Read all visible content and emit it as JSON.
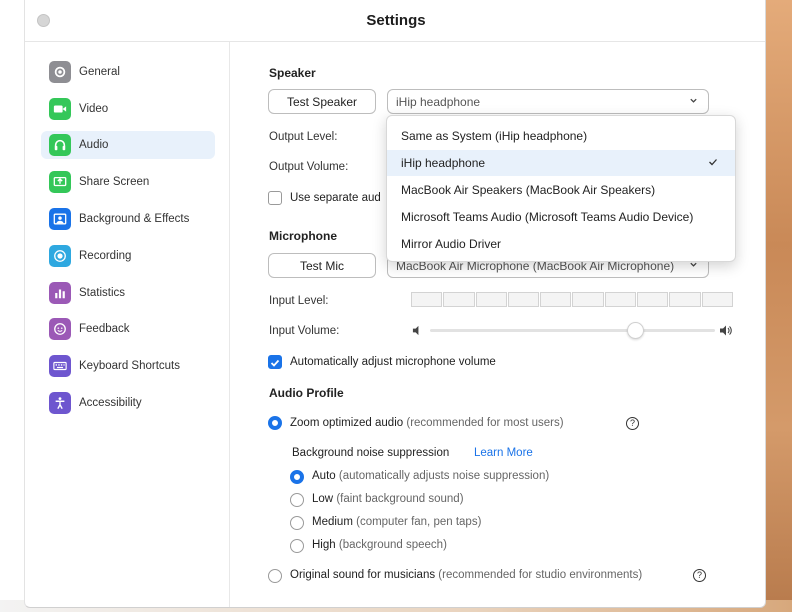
{
  "window": {
    "title": "Settings"
  },
  "sidebar": {
    "items": [
      {
        "label": "General",
        "icon": "gear-icon",
        "color": "#8e8e93",
        "active": false
      },
      {
        "label": "Video",
        "icon": "video-camera-icon",
        "color": "#34c759",
        "active": false
      },
      {
        "label": "Audio",
        "icon": "headphones-icon",
        "color": "#34c759",
        "active": true
      },
      {
        "label": "Share Screen",
        "icon": "share-screen-icon",
        "color": "#34c759",
        "active": false
      },
      {
        "label": "Background & Effects",
        "icon": "background-icon",
        "color": "#1a73e8",
        "active": false
      },
      {
        "label": "Recording",
        "icon": "recording-icon",
        "color": "#2ea8e0",
        "active": false
      },
      {
        "label": "Statistics",
        "icon": "statistics-icon",
        "color": "#9b59b6",
        "active": false
      },
      {
        "label": "Feedback",
        "icon": "feedback-icon",
        "color": "#9b59b6",
        "active": false
      },
      {
        "label": "Keyboard Shortcuts",
        "icon": "keyboard-icon",
        "color": "#6e56cf",
        "active": false
      },
      {
        "label": "Accessibility",
        "icon": "accessibility-icon",
        "color": "#6e56cf",
        "active": false
      }
    ]
  },
  "speaker": {
    "title": "Speaker",
    "test_button": "Test Speaker",
    "selected": "iHip headphone",
    "output_level_label": "Output Level:",
    "output_volume_label": "Output Volume:",
    "separate_checkbox_label": "Use separate aud",
    "separate_checked": false,
    "options": [
      {
        "label": "Same as System (iHip headphone)",
        "selected": false
      },
      {
        "label": "iHip headphone",
        "selected": true
      },
      {
        "label": "MacBook Air Speakers (MacBook Air Speakers)",
        "selected": false
      },
      {
        "label": "Microsoft Teams Audio (Microsoft Teams Audio Device)",
        "selected": false
      },
      {
        "label": "Mirror Audio Driver",
        "selected": false
      }
    ]
  },
  "microphone": {
    "title": "Microphone",
    "test_button": "Test Mic",
    "selected": "MacBook Air Microphone (MacBook Air Microphone)",
    "input_level_label": "Input Level:",
    "input_volume_label": "Input Volume:",
    "input_volume_fraction": 0.72,
    "auto_adjust_label": "Automatically adjust microphone volume",
    "auto_adjust_checked": true
  },
  "audio_profile": {
    "title": "Audio Profile",
    "zoom_optimized": {
      "label": "Zoom optimized audio",
      "hint": "(recommended for most users)",
      "checked": true
    },
    "noise_suppression_label": "Background noise suppression",
    "learn_more": "Learn More",
    "noise_options": [
      {
        "label": "Auto",
        "hint": "(automatically adjusts noise suppression)",
        "checked": true
      },
      {
        "label": "Low",
        "hint": "(faint background sound)",
        "checked": false
      },
      {
        "label": "Medium",
        "hint": "(computer fan, pen taps)",
        "checked": false
      },
      {
        "label": "High",
        "hint": "(background speech)",
        "checked": false
      }
    ],
    "original_sound": {
      "label": "Original sound for musicians",
      "hint": "(recommended for studio environments)",
      "checked": false
    }
  },
  "colors": {
    "accent": "#1a73e8",
    "active_bg": "#e8f1fb"
  }
}
